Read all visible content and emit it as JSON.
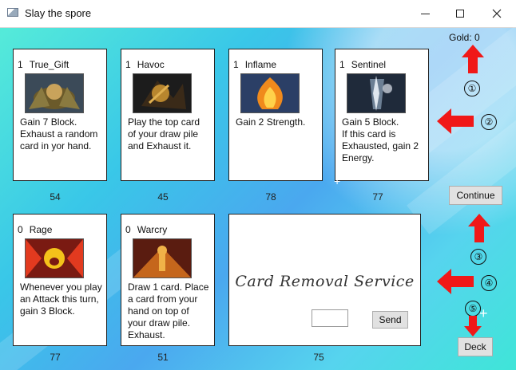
{
  "window": {
    "title": "Slay the spore",
    "icons": {
      "app": "app-icon",
      "minimize": "minimize-icon",
      "maximize": "maximize-icon",
      "close": "close-icon"
    }
  },
  "shop": {
    "gold_label": "Gold: 0",
    "cards": [
      {
        "cost": "1",
        "name": "True_Gift",
        "description": "Gain 7 Block. Exhaust a random card in yor hand.",
        "price": "54",
        "art_colors": [
          "#6b5a2a",
          "#c9a35b",
          "#3b4a58"
        ]
      },
      {
        "cost": "1",
        "name": "Havoc",
        "description": "Play the top card of your draw pile and Exhaust it.",
        "price": "45",
        "art_colors": [
          "#3a2a18",
          "#b8862e",
          "#1c1c1c"
        ]
      },
      {
        "cost": "1",
        "name": "Inflame",
        "description": "Gain 2 Strength.",
        "price": "78",
        "art_colors": [
          "#2b3f66",
          "#f08a1c",
          "#ffd24a"
        ]
      },
      {
        "cost": "1",
        "name": "Sentinel",
        "description": "Gain 5 Block.\nIf this card is Exhausted, gain 2 Energy.",
        "price": "77",
        "art_colors": [
          "#1f2a3a",
          "#dfe6ee",
          "#6c7f94"
        ]
      },
      {
        "cost": "0",
        "name": "Rage",
        "description": "Whenever you play an Attack this turn, gain 3 Block.",
        "price": "77",
        "art_colors": [
          "#7a1a12",
          "#e23a1f",
          "#f4c21a"
        ]
      },
      {
        "cost": "0",
        "name": "Warcry",
        "description": "Draw 1 card. Place a card from your hand on top of your draw pile. Exhaust.",
        "price": "51",
        "art_colors": [
          "#5a1c10",
          "#c5661c",
          "#f0b248"
        ]
      }
    ],
    "removal": {
      "title": "Card Removal Service",
      "input_value": "",
      "send_label": "Send",
      "price": "75"
    },
    "continue_label": "Continue",
    "deck_label": "Deck"
  },
  "annotations": [
    {
      "number": "①",
      "arrow": "up"
    },
    {
      "number": "②",
      "arrow": "left"
    },
    {
      "number": "③",
      "arrow": "up"
    },
    {
      "number": "④",
      "arrow": "left"
    },
    {
      "number": "⑤",
      "arrow": "down"
    }
  ],
  "colors": {
    "arrow": "#f01818",
    "accent_background": "#3fd0e6"
  }
}
